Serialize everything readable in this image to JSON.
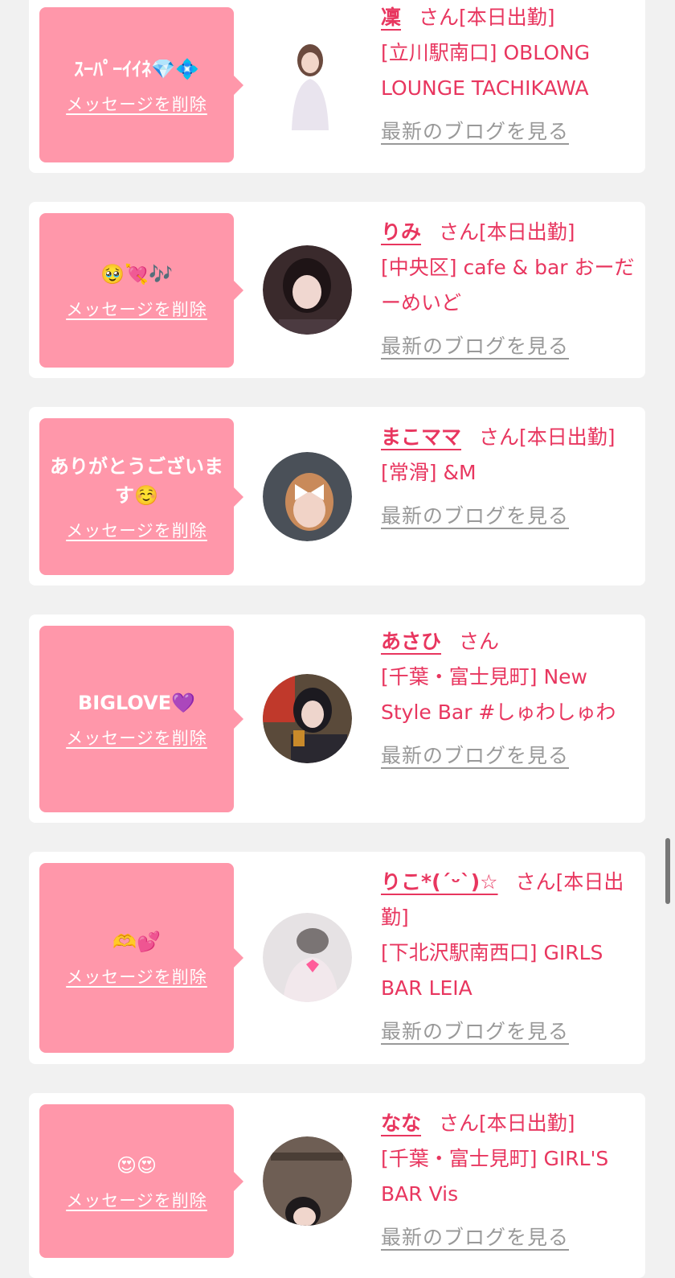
{
  "delete_label": "メッセージを削除",
  "blog_label": "最新のブログを見る",
  "san_label": "さん",
  "cards": [
    {
      "message": "ｽｰﾊﾟｰｲｲﾈ💎💠",
      "name": "凜",
      "status": "[本日出勤]",
      "shop": "[立川駅南口] OBLONG LOUNGE TACHIKAWA"
    },
    {
      "message": "🥹💘🎶",
      "name": "りみ",
      "status": "[本日出勤]",
      "shop": "[中央区] cafe & bar おーだーめいど"
    },
    {
      "message": "ありがとうございます☺️",
      "name": "まこママ",
      "status": "[本日出勤]",
      "shop": "[常滑] &M"
    },
    {
      "message": "BIGLOVE💜",
      "name": "あさひ",
      "status": "",
      "shop": "[千葉・富士見町] New Style Bar #しゅわしゅわ"
    },
    {
      "message": "🫶💕",
      "name": "りこ*(ˊᵕˋ)☆",
      "status": "[本日出勤]",
      "shop": "[下北沢駅南西口] GIRLS BAR LEIA"
    },
    {
      "message": "😍😍",
      "name": "なな",
      "status": "[本日出勤]",
      "shop": "[千葉・富士見町] GIRL'S BAR Vis"
    }
  ]
}
